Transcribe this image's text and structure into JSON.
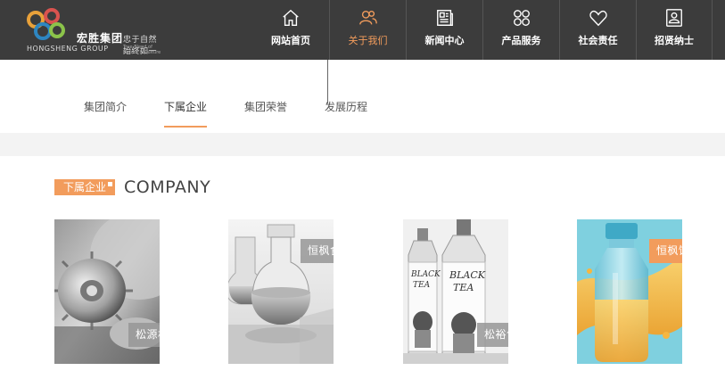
{
  "header": {
    "brand_cn": "宏胜集团",
    "brand_en": "HONGSHENG GROUP",
    "slogan": "忠于自然  始终如一",
    "tagline_en": "True Blend of Nature & Culture",
    "nav": [
      {
        "label": "网站首页",
        "icon": "home-icon"
      },
      {
        "label": "关于我们",
        "icon": "people-icon",
        "active": true
      },
      {
        "label": "新闻中心",
        "icon": "newspaper-icon"
      },
      {
        "label": "产品服务",
        "icon": "grid-icon"
      },
      {
        "label": "社会责任",
        "icon": "heart-icon"
      },
      {
        "label": "招贤纳士",
        "icon": "id-card-icon"
      }
    ]
  },
  "subnav": {
    "items": [
      {
        "label": "集团简介"
      },
      {
        "label": "下属企业",
        "active": true
      },
      {
        "label": "集团荣誉"
      },
      {
        "label": "发展历程"
      }
    ]
  },
  "section": {
    "tag": "下属企业",
    "title_en": "COMPANY"
  },
  "companies": [
    {
      "name": "松源机械"
    },
    {
      "name": "恒枫食品"
    },
    {
      "name": "松裕包装"
    },
    {
      "name": "恒枫饮料"
    }
  ],
  "colors": {
    "accent": "#f29c5c",
    "header_bg": "#3c3c3c"
  }
}
